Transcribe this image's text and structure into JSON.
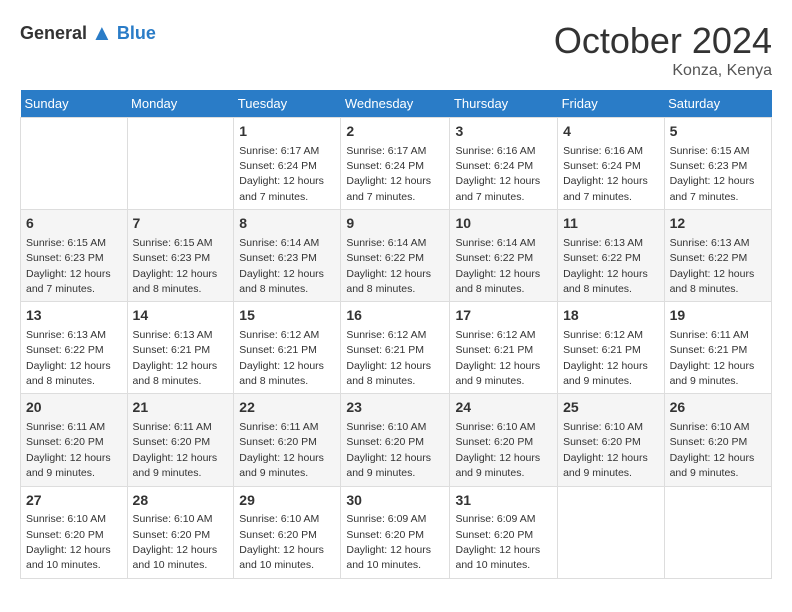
{
  "header": {
    "logo_general": "General",
    "logo_blue": "Blue",
    "month_title": "October 2024",
    "location": "Konza, Kenya"
  },
  "weekdays": [
    "Sunday",
    "Monday",
    "Tuesday",
    "Wednesday",
    "Thursday",
    "Friday",
    "Saturday"
  ],
  "weeks": [
    [
      null,
      null,
      {
        "day": 1,
        "sunrise": "6:17 AM",
        "sunset": "6:24 PM",
        "daylight": "12 hours and 7 minutes."
      },
      {
        "day": 2,
        "sunrise": "6:17 AM",
        "sunset": "6:24 PM",
        "daylight": "12 hours and 7 minutes."
      },
      {
        "day": 3,
        "sunrise": "6:16 AM",
        "sunset": "6:24 PM",
        "daylight": "12 hours and 7 minutes."
      },
      {
        "day": 4,
        "sunrise": "6:16 AM",
        "sunset": "6:24 PM",
        "daylight": "12 hours and 7 minutes."
      },
      {
        "day": 5,
        "sunrise": "6:15 AM",
        "sunset": "6:23 PM",
        "daylight": "12 hours and 7 minutes."
      }
    ],
    [
      {
        "day": 6,
        "sunrise": "6:15 AM",
        "sunset": "6:23 PM",
        "daylight": "12 hours and 7 minutes."
      },
      {
        "day": 7,
        "sunrise": "6:15 AM",
        "sunset": "6:23 PM",
        "daylight": "12 hours and 8 minutes."
      },
      {
        "day": 8,
        "sunrise": "6:14 AM",
        "sunset": "6:23 PM",
        "daylight": "12 hours and 8 minutes."
      },
      {
        "day": 9,
        "sunrise": "6:14 AM",
        "sunset": "6:22 PM",
        "daylight": "12 hours and 8 minutes."
      },
      {
        "day": 10,
        "sunrise": "6:14 AM",
        "sunset": "6:22 PM",
        "daylight": "12 hours and 8 minutes."
      },
      {
        "day": 11,
        "sunrise": "6:13 AM",
        "sunset": "6:22 PM",
        "daylight": "12 hours and 8 minutes."
      },
      {
        "day": 12,
        "sunrise": "6:13 AM",
        "sunset": "6:22 PM",
        "daylight": "12 hours and 8 minutes."
      }
    ],
    [
      {
        "day": 13,
        "sunrise": "6:13 AM",
        "sunset": "6:22 PM",
        "daylight": "12 hours and 8 minutes."
      },
      {
        "day": 14,
        "sunrise": "6:13 AM",
        "sunset": "6:21 PM",
        "daylight": "12 hours and 8 minutes."
      },
      {
        "day": 15,
        "sunrise": "6:12 AM",
        "sunset": "6:21 PM",
        "daylight": "12 hours and 8 minutes."
      },
      {
        "day": 16,
        "sunrise": "6:12 AM",
        "sunset": "6:21 PM",
        "daylight": "12 hours and 8 minutes."
      },
      {
        "day": 17,
        "sunrise": "6:12 AM",
        "sunset": "6:21 PM",
        "daylight": "12 hours and 9 minutes."
      },
      {
        "day": 18,
        "sunrise": "6:12 AM",
        "sunset": "6:21 PM",
        "daylight": "12 hours and 9 minutes."
      },
      {
        "day": 19,
        "sunrise": "6:11 AM",
        "sunset": "6:21 PM",
        "daylight": "12 hours and 9 minutes."
      }
    ],
    [
      {
        "day": 20,
        "sunrise": "6:11 AM",
        "sunset": "6:20 PM",
        "daylight": "12 hours and 9 minutes."
      },
      {
        "day": 21,
        "sunrise": "6:11 AM",
        "sunset": "6:20 PM",
        "daylight": "12 hours and 9 minutes."
      },
      {
        "day": 22,
        "sunrise": "6:11 AM",
        "sunset": "6:20 PM",
        "daylight": "12 hours and 9 minutes."
      },
      {
        "day": 23,
        "sunrise": "6:10 AM",
        "sunset": "6:20 PM",
        "daylight": "12 hours and 9 minutes."
      },
      {
        "day": 24,
        "sunrise": "6:10 AM",
        "sunset": "6:20 PM",
        "daylight": "12 hours and 9 minutes."
      },
      {
        "day": 25,
        "sunrise": "6:10 AM",
        "sunset": "6:20 PM",
        "daylight": "12 hours and 9 minutes."
      },
      {
        "day": 26,
        "sunrise": "6:10 AM",
        "sunset": "6:20 PM",
        "daylight": "12 hours and 9 minutes."
      }
    ],
    [
      {
        "day": 27,
        "sunrise": "6:10 AM",
        "sunset": "6:20 PM",
        "daylight": "12 hours and 10 minutes."
      },
      {
        "day": 28,
        "sunrise": "6:10 AM",
        "sunset": "6:20 PM",
        "daylight": "12 hours and 10 minutes."
      },
      {
        "day": 29,
        "sunrise": "6:10 AM",
        "sunset": "6:20 PM",
        "daylight": "12 hours and 10 minutes."
      },
      {
        "day": 30,
        "sunrise": "6:09 AM",
        "sunset": "6:20 PM",
        "daylight": "12 hours and 10 minutes."
      },
      {
        "day": 31,
        "sunrise": "6:09 AM",
        "sunset": "6:20 PM",
        "daylight": "12 hours and 10 minutes."
      },
      null,
      null
    ]
  ],
  "labels": {
    "sunrise_prefix": "Sunrise: ",
    "sunset_prefix": "Sunset: ",
    "daylight_prefix": "Daylight: "
  }
}
